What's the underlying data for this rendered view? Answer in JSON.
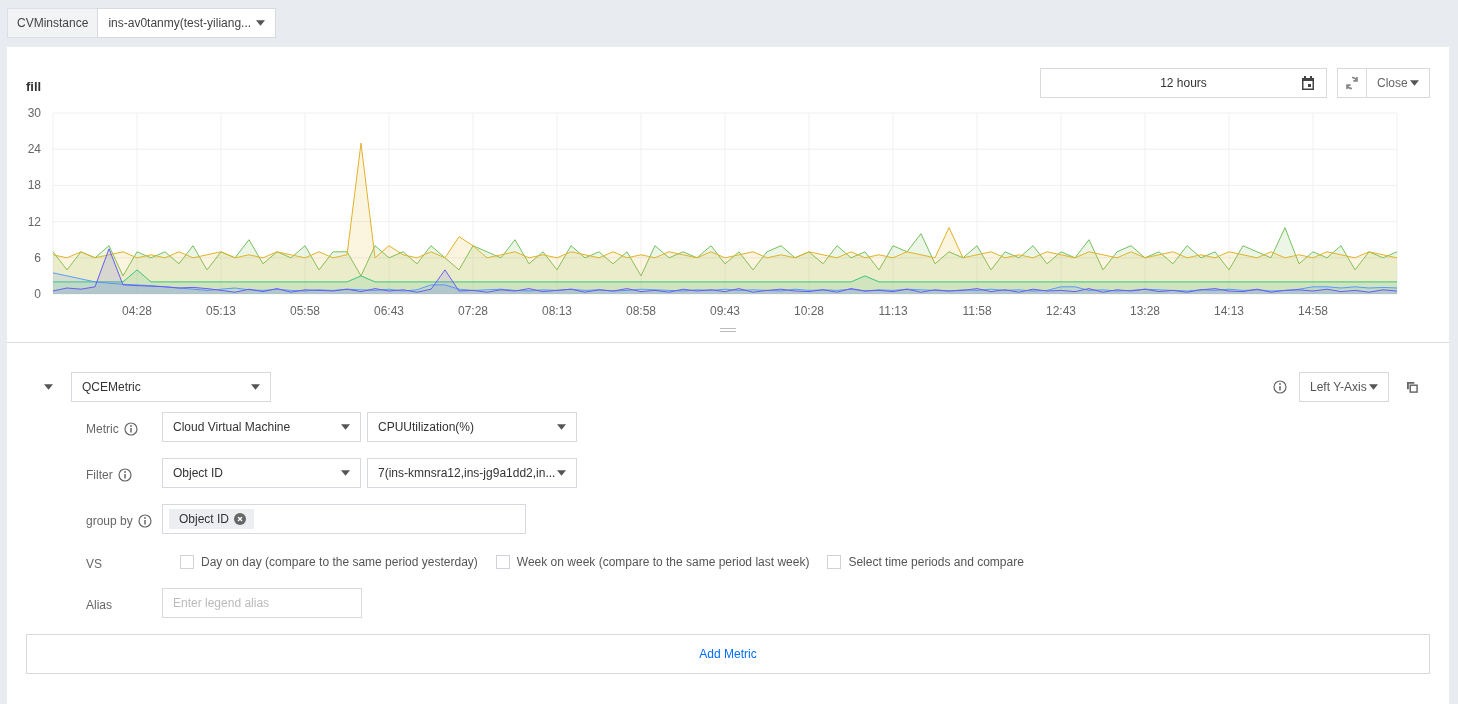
{
  "instance_selector": {
    "label": "CVMinstance",
    "value": "ins-av0tanmy(test-yiliang..."
  },
  "panel": {
    "title": "fill",
    "time_range": "12 hours",
    "refresh_mode": "Close",
    "chart_data": {
      "type": "area",
      "grid": true,
      "categories": [
        null,
        null,
        null,
        null,
        null,
        null,
        "04:28",
        null,
        null,
        null,
        null,
        null,
        "05:13",
        null,
        null,
        null,
        null,
        null,
        "05:58",
        null,
        null,
        null,
        null,
        null,
        "06:43",
        null,
        null,
        null,
        null,
        null,
        "07:28",
        null,
        null,
        null,
        null,
        null,
        "08:13",
        null,
        null,
        null,
        null,
        null,
        "08:58",
        null,
        null,
        null,
        null,
        null,
        "09:43",
        null,
        null,
        null,
        null,
        null,
        "10:28",
        null,
        null,
        null,
        null,
        null,
        "11:13",
        null,
        null,
        null,
        null,
        null,
        "11:58",
        null,
        null,
        null,
        null,
        null,
        "12:43",
        null,
        null,
        null,
        null,
        null,
        "13:28",
        null,
        null,
        null,
        null,
        null,
        "14:13",
        null,
        null,
        null,
        null,
        null,
        "14:58",
        null,
        null,
        null,
        null,
        null,
        null
      ],
      "ylim": [
        0,
        30
      ],
      "yticks": [
        0,
        6,
        12,
        18,
        24,
        30
      ],
      "series": [
        {
          "color": "#77c05f",
          "values": [
            7,
            4,
            7,
            6,
            8,
            3,
            7,
            6,
            7,
            5,
            8,
            4,
            7,
            6,
            9,
            5,
            7,
            6,
            8,
            4,
            7,
            7,
            3,
            8,
            6,
            7,
            5,
            8,
            6,
            4,
            8,
            7,
            6,
            9,
            5,
            7,
            4,
            8,
            6,
            7,
            5,
            7,
            3,
            8,
            6,
            7,
            6,
            8,
            5,
            7,
            4,
            7,
            8,
            6,
            7,
            5,
            8,
            6,
            7,
            4,
            8,
            7,
            10,
            5,
            7,
            6,
            8,
            4,
            7,
            6,
            8,
            5,
            7,
            6,
            9,
            4,
            7,
            8,
            6,
            7,
            5,
            8,
            6,
            7,
            4,
            8,
            7,
            6,
            11,
            5,
            7,
            6,
            8,
            4,
            7,
            6,
            7
          ]
        },
        {
          "color": "#e2b22b",
          "values": [
            6.5,
            6,
            7,
            6,
            6.5,
            7,
            6,
            6.5,
            6,
            7,
            6,
            6.5,
            7,
            6,
            6.5,
            6,
            7,
            6.5,
            6,
            7,
            6,
            6.5,
            25,
            6,
            8,
            6.5,
            6,
            7,
            6,
            9.5,
            8,
            6,
            6.5,
            7,
            6,
            6.5,
            6,
            7,
            6.5,
            6,
            7,
            6,
            6.5,
            6,
            7,
            6.5,
            6,
            7,
            6,
            6.5,
            7,
            6,
            6.5,
            6,
            7,
            6.5,
            6,
            7,
            6,
            6.5,
            6,
            7,
            6.5,
            6,
            11,
            6,
            6.5,
            7,
            6,
            6.5,
            6,
            7,
            6.5,
            6,
            7,
            6.5,
            6,
            7,
            6,
            6.5,
            7,
            6,
            6.5,
            6,
            7,
            6.5,
            6,
            7,
            6,
            6.5,
            6,
            7,
            6.5,
            6,
            7,
            6.5,
            6
          ]
        },
        {
          "color": "#3cc47c",
          "values": [
            2,
            2,
            2,
            2,
            2,
            2,
            4,
            2,
            2,
            2,
            2,
            2,
            2,
            2,
            2,
            2,
            2,
            2,
            2,
            2,
            2,
            2,
            3,
            2,
            2,
            2,
            2,
            2,
            2,
            2,
            2,
            2,
            2,
            2,
            2,
            2,
            2,
            2,
            2,
            2,
            2,
            2,
            2,
            2,
            2,
            2,
            2,
            2,
            2,
            2,
            2,
            2,
            2,
            2,
            2,
            2,
            2,
            2,
            3,
            2,
            2,
            2,
            2,
            2,
            2,
            2,
            2,
            2,
            2,
            2,
            2,
            2,
            2,
            2,
            2,
            2,
            2,
            2,
            2,
            2,
            2,
            2,
            2,
            2,
            2,
            2,
            2,
            2,
            2,
            2,
            2,
            2,
            2,
            2,
            2,
            2,
            2
          ]
        },
        {
          "color": "#5b9bf9",
          "values": [
            3.5,
            3,
            2.5,
            2,
            1.8,
            1.6,
            1.5,
            1.4,
            1.2,
            1,
            0.8,
            0.6,
            0.8,
            1,
            0.7,
            0.6,
            0.8,
            0.6,
            0.5,
            0.7,
            0.6,
            0.8,
            0.7,
            0.6,
            0.8,
            0.5,
            0.7,
            1.5,
            1.5,
            0.8,
            0.6,
            0.7,
            0.8,
            0.6,
            0.5,
            0.7,
            0.6,
            0.8,
            0.6,
            0.7,
            0.5,
            0.6,
            0.8,
            0.7,
            0.6,
            0.5,
            0.7,
            0.6,
            0.8,
            0.6,
            0.7,
            0.6,
            0.5,
            0.8,
            0.6,
            0.7,
            0.6,
            0.8,
            0.5,
            0.7,
            0.6,
            0.8,
            0.7,
            0.6,
            0.5,
            0.7,
            0.6,
            0.8,
            0.6,
            0.7,
            0.5,
            0.6,
            1.2,
            1.2,
            0.6,
            0.7,
            0.5,
            0.6,
            0.8,
            0.7,
            0.6,
            0.5,
            0.7,
            0.6,
            0.8,
            0.6,
            0.7,
            0.5,
            0.6,
            0.8,
            1.2,
            1.2,
            1,
            1.2,
            1,
            1.1,
            1
          ]
        },
        {
          "color": "#6a5cf0",
          "values": [
            0.5,
            1,
            0.8,
            1.2,
            7.5,
            1.5,
            1.4,
            1.3,
            1.2,
            1,
            1.1,
            0.9,
            0.6,
            0.3,
            0.8,
            0.4,
            0.9,
            0.3,
            0.7,
            0.6,
            0.5,
            0.8,
            0.4,
            0.9,
            0.5,
            0.7,
            0.3,
            0.8,
            4,
            0.5,
            0.6,
            0.3,
            0.7,
            0.5,
            0.9,
            0.4,
            0.6,
            0.8,
            0.3,
            0.7,
            0.5,
            0.9,
            0.4,
            0.6,
            0.3,
            0.8,
            0.5,
            0.7,
            0.4,
            0.9,
            0.3,
            0.6,
            0.8,
            0.5,
            0.4,
            0.7,
            0.3,
            0.9,
            0.5,
            0.6,
            0.4,
            0.8,
            0.3,
            0.7,
            0.5,
            0.6,
            0.9,
            0.4,
            0.7,
            0.3,
            0.8,
            0.5,
            0.6,
            0.4,
            0.9,
            0.3,
            0.7,
            0.5,
            0.8,
            0.4,
            0.6,
            0.3,
            0.7,
            0.9,
            0.5,
            0.4,
            0.8,
            0.3,
            0.6,
            0.7,
            0.5,
            0.8,
            0.4,
            0.6,
            0.3,
            0.7,
            0.5
          ]
        }
      ]
    }
  },
  "query": {
    "expanded": true,
    "source": "QCEMetric",
    "axis": "Left Y-Axis",
    "rows": [
      {
        "kind": "selects",
        "label": "Metric",
        "info": true,
        "values": [
          "Cloud Virtual Machine",
          "CPUUtilization(%)"
        ]
      },
      {
        "kind": "selects",
        "label": "Filter",
        "info": true,
        "values": [
          "Object ID",
          "7(ins-kmnsra12,ins-jg9a1dd2,in..."
        ]
      },
      {
        "kind": "tags",
        "label": "group by",
        "info": true,
        "tags": [
          "Object ID"
        ]
      },
      {
        "kind": "checks",
        "label": "VS",
        "options": [
          {
            "label": "Day on day (compare to the same period yesterday)",
            "checked": false
          },
          {
            "label": "Week on week (compare to the same period last week)",
            "checked": false
          },
          {
            "label": "Select time periods and compare",
            "checked": false
          }
        ]
      },
      {
        "kind": "input",
        "label": "Alias",
        "placeholder": "Enter legend alias"
      }
    ]
  },
  "add_button": "Add Metric"
}
